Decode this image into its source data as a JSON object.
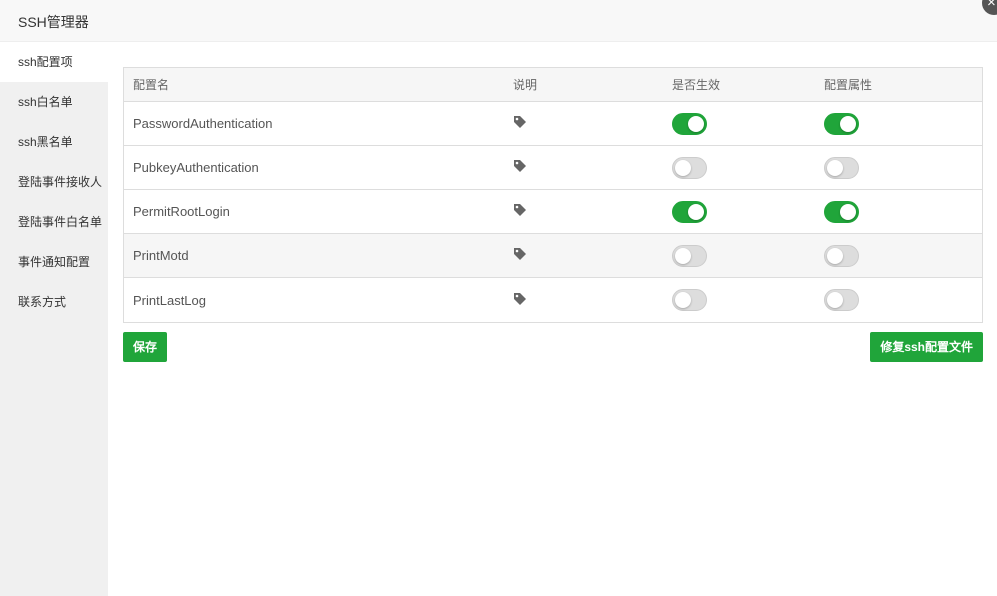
{
  "window": {
    "title": "SSH管理器",
    "close_glyph": "×"
  },
  "sidebar": {
    "items": [
      {
        "label": "ssh配置项",
        "active": true
      },
      {
        "label": "ssh白名单",
        "active": false
      },
      {
        "label": "ssh黑名单",
        "active": false
      },
      {
        "label": "登陆事件接收人",
        "active": false
      },
      {
        "label": "登陆事件白名单",
        "active": false
      },
      {
        "label": "事件通知配置",
        "active": false
      },
      {
        "label": "联系方式",
        "active": false
      }
    ]
  },
  "table": {
    "headers": {
      "name": "配置名",
      "desc": "说明",
      "enabled": "是否生效",
      "attr": "配置属性"
    },
    "rows": [
      {
        "name": "PasswordAuthentication",
        "desc_icon": "tag-icon",
        "enabled": true,
        "attr": true
      },
      {
        "name": "PubkeyAuthentication",
        "desc_icon": "tag-icon",
        "enabled": false,
        "attr": false
      },
      {
        "name": "PermitRootLogin",
        "desc_icon": "tag-icon",
        "enabled": true,
        "attr": true
      },
      {
        "name": "PrintMotd",
        "desc_icon": "tag-icon",
        "enabled": false,
        "attr": false
      },
      {
        "name": "PrintLastLog",
        "desc_icon": "tag-icon",
        "enabled": false,
        "attr": false
      }
    ]
  },
  "actions": {
    "save_label": "保存",
    "repair_label": "修复ssh配置文件"
  },
  "colors": {
    "accent": "#20a53a",
    "switch_off": "#dddddd",
    "sidebar_bg": "#f0f0f0"
  }
}
